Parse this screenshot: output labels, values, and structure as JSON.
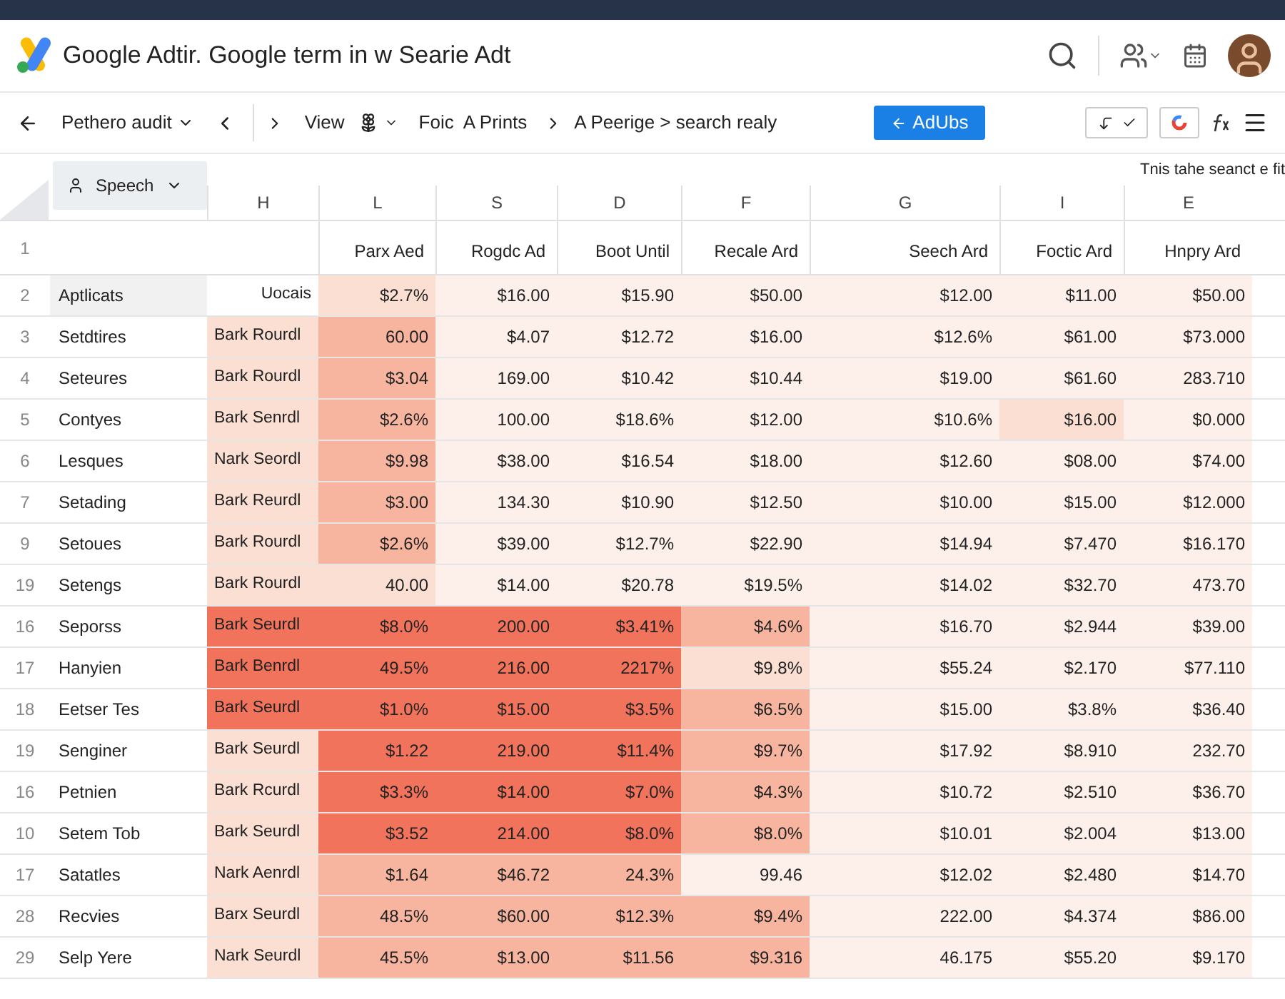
{
  "app": {
    "title": "Google Adtir. Google term in w Searie Adt"
  },
  "toolbar": {
    "document": "Pethero audit",
    "view": "View",
    "breadcrumb": "Foic  A Prints",
    "path": "A Peerige > search realy",
    "button": "AdUbs"
  },
  "sheet": {
    "name_box": "Speech",
    "note": "Tnis tahe seanct e fit",
    "column_letters": [
      "H",
      "L",
      "S",
      "D",
      "F",
      "G",
      "I",
      "E"
    ],
    "title_row_number": "1",
    "column_titles": [
      "Parx Aed",
      "Rogdc Ad",
      "Boot Until",
      "Recale Ard",
      "Seech Ard",
      "Foctic Ard",
      "Hnpry Ard"
    ],
    "rows": [
      {
        "number": "2",
        "kind": "header",
        "name": "Aptlicats",
        "cells": [
          {
            "text": "Uocais",
            "color": "#ffffff"
          },
          {
            "text": "$2.7%",
            "color": "#fbdfd3"
          },
          {
            "text": "$16.00",
            "color": "#fdf0ea"
          },
          {
            "text": "$15.90",
            "color": "#fdf0ea"
          },
          {
            "text": "$50.00",
            "color": "#fdf0ea"
          },
          {
            "text": "$12.00",
            "color": "#fdf0ea"
          },
          {
            "text": "$11.00",
            "color": "#fdf0ea"
          },
          {
            "text": "$50.00",
            "color": "#fdf0ea"
          }
        ]
      },
      {
        "number": "3",
        "kind": "data",
        "name": "Setdtires",
        "cells": [
          {
            "text": "Bark Rourdl",
            "color": "#fbdfd3"
          },
          {
            "text": "60.00",
            "color": "#f7b59f"
          },
          {
            "text": "$4.07",
            "color": "#fdf0ea"
          },
          {
            "text": "$12.72",
            "color": "#fdf0ea"
          },
          {
            "text": "$16.00",
            "color": "#fdf0ea"
          },
          {
            "text": "$12.6%",
            "color": "#fdf0ea"
          },
          {
            "text": "$61.00",
            "color": "#fdf0ea"
          },
          {
            "text": "$73.000",
            "color": "#fdf0ea"
          }
        ]
      },
      {
        "number": "4",
        "kind": "data",
        "name": "Seteures",
        "cells": [
          {
            "text": "Bark Rourdl",
            "color": "#fbdfd3"
          },
          {
            "text": "$3.04",
            "color": "#f7b59f"
          },
          {
            "text": "169.00",
            "color": "#fdf0ea"
          },
          {
            "text": "$10.42",
            "color": "#fdf0ea"
          },
          {
            "text": "$10.44",
            "color": "#fdf0ea"
          },
          {
            "text": "$19.00",
            "color": "#fdf0ea"
          },
          {
            "text": "$61.60",
            "color": "#fdf0ea"
          },
          {
            "text": "283.710",
            "color": "#fdf0ea"
          }
        ]
      },
      {
        "number": "5",
        "kind": "data",
        "name": "Contyes",
        "cells": [
          {
            "text": "Bark Senrdl",
            "color": "#fbdfd3"
          },
          {
            "text": "$2.6%",
            "color": "#f7b59f"
          },
          {
            "text": "100.00",
            "color": "#fdf0ea"
          },
          {
            "text": "$18.6%",
            "color": "#fdf0ea"
          },
          {
            "text": "$12.00",
            "color": "#fdf0ea"
          },
          {
            "text": "$10.6%",
            "color": "#fdf0ea"
          },
          {
            "text": "$16.00",
            "color": "#fbdfd3"
          },
          {
            "text": "$0.000",
            "color": "#fdf0ea"
          }
        ]
      },
      {
        "number": "6",
        "kind": "data",
        "name": "Lesques",
        "cells": [
          {
            "text": "Nark Seordl",
            "color": "#fbdfd3"
          },
          {
            "text": "$9.98",
            "color": "#f7b59f"
          },
          {
            "text": "$38.00",
            "color": "#fdf0ea"
          },
          {
            "text": "$16.54",
            "color": "#fdf0ea"
          },
          {
            "text": "$18.00",
            "color": "#fdf0ea"
          },
          {
            "text": "$12.60",
            "color": "#fdf0ea"
          },
          {
            "text": "$08.00",
            "color": "#fdf0ea"
          },
          {
            "text": "$74.00",
            "color": "#fdf0ea"
          }
        ]
      },
      {
        "number": "7",
        "kind": "data",
        "name": "Setading",
        "cells": [
          {
            "text": "Bark Reurdl",
            "color": "#fbdfd3"
          },
          {
            "text": "$3.00",
            "color": "#f7b59f"
          },
          {
            "text": "134.30",
            "color": "#fdf0ea"
          },
          {
            "text": "$10.90",
            "color": "#fdf0ea"
          },
          {
            "text": "$12.50",
            "color": "#fdf0ea"
          },
          {
            "text": "$10.00",
            "color": "#fdf0ea"
          },
          {
            "text": "$15.00",
            "color": "#fdf0ea"
          },
          {
            "text": "$12.000",
            "color": "#fdf0ea"
          }
        ]
      },
      {
        "number": "9",
        "kind": "data",
        "name": "Setoues",
        "cells": [
          {
            "text": "Bark Rourdl",
            "color": "#fbdfd3"
          },
          {
            "text": "$2.6%",
            "color": "#f7b59f"
          },
          {
            "text": "$39.00",
            "color": "#fdf0ea"
          },
          {
            "text": "$12.7%",
            "color": "#fdf0ea"
          },
          {
            "text": "$22.90",
            "color": "#fdf0ea"
          },
          {
            "text": "$14.94",
            "color": "#fdf0ea"
          },
          {
            "text": "$7.470",
            "color": "#fdf0ea"
          },
          {
            "text": "$16.170",
            "color": "#fdf0ea"
          }
        ]
      },
      {
        "number": "19",
        "kind": "data",
        "name": "Setengs",
        "cells": [
          {
            "text": "Bark Rourdl",
            "color": "#fbdfd3"
          },
          {
            "text": "40.00",
            "color": "#fbdfd3"
          },
          {
            "text": "$14.00",
            "color": "#fdf0ea"
          },
          {
            "text": "$20.78",
            "color": "#fdf0ea"
          },
          {
            "text": "$19.5%",
            "color": "#fdf0ea"
          },
          {
            "text": "$14.02",
            "color": "#fdf0ea"
          },
          {
            "text": "$32.70",
            "color": "#fdf0ea"
          },
          {
            "text": "473.70",
            "color": "#fdf0ea"
          }
        ]
      },
      {
        "number": "16",
        "kind": "data",
        "name": "Seporss",
        "cells": [
          {
            "text": "Bark Seurdl",
            "color": "#f1735b"
          },
          {
            "text": "$8.0%",
            "color": "#f1735b"
          },
          {
            "text": "200.00",
            "color": "#f1735b"
          },
          {
            "text": "$3.41%",
            "color": "#f1735b"
          },
          {
            "text": "$4.6%",
            "color": "#f7b59f"
          },
          {
            "text": "$16.70",
            "color": "#fdf0ea"
          },
          {
            "text": "$2.944",
            "color": "#fdf0ea"
          },
          {
            "text": "$39.00",
            "color": "#fdf0ea"
          }
        ]
      },
      {
        "number": "17",
        "kind": "data",
        "name": "Hanyien",
        "cells": [
          {
            "text": "Bark Benrdl",
            "color": "#f1735b"
          },
          {
            "text": "49.5%",
            "color": "#f1735b"
          },
          {
            "text": "216.00",
            "color": "#f1735b"
          },
          {
            "text": "2217%",
            "color": "#f1735b"
          },
          {
            "text": "$9.8%",
            "color": "#fbdfd3"
          },
          {
            "text": "$55.24",
            "color": "#fdf0ea"
          },
          {
            "text": "$2.170",
            "color": "#fdf0ea"
          },
          {
            "text": "$77.110",
            "color": "#fdf0ea"
          }
        ]
      },
      {
        "number": "18",
        "kind": "data",
        "name": "Eetser Tes",
        "cells": [
          {
            "text": "Bark Seurdl",
            "color": "#f1735b"
          },
          {
            "text": "$1.0%",
            "color": "#f1735b"
          },
          {
            "text": "$15.00",
            "color": "#f1735b"
          },
          {
            "text": "$3.5%",
            "color": "#f1735b"
          },
          {
            "text": "$6.5%",
            "color": "#f7b59f"
          },
          {
            "text": "$15.00",
            "color": "#fdf0ea"
          },
          {
            "text": "$3.8%",
            "color": "#fdf0ea"
          },
          {
            "text": "$36.40",
            "color": "#fdf0ea"
          }
        ]
      },
      {
        "number": "19",
        "kind": "data",
        "name": "Senginer",
        "cells": [
          {
            "text": "Bark Seurdl",
            "color": "#fbdfd3"
          },
          {
            "text": "$1.22",
            "color": "#f1735b"
          },
          {
            "text": "219.00",
            "color": "#f1735b"
          },
          {
            "text": "$11.4%",
            "color": "#f1735b"
          },
          {
            "text": "$9.7%",
            "color": "#f7b59f"
          },
          {
            "text": "$17.92",
            "color": "#fdf0ea"
          },
          {
            "text": "$8.910",
            "color": "#fdf0ea"
          },
          {
            "text": "232.70",
            "color": "#fdf0ea"
          }
        ]
      },
      {
        "number": "16",
        "kind": "data",
        "name": "Petnien",
        "cells": [
          {
            "text": "Bark Rcurdl",
            "color": "#fbdfd3"
          },
          {
            "text": "$3.3%",
            "color": "#f1735b"
          },
          {
            "text": "$14.00",
            "color": "#f1735b"
          },
          {
            "text": "$7.0%",
            "color": "#f1735b"
          },
          {
            "text": "$4.3%",
            "color": "#f7b59f"
          },
          {
            "text": "$10.72",
            "color": "#fdf0ea"
          },
          {
            "text": "$2.510",
            "color": "#fdf0ea"
          },
          {
            "text": "$36.70",
            "color": "#fdf0ea"
          }
        ]
      },
      {
        "number": "10",
        "kind": "data",
        "name": "Setem Tob",
        "cells": [
          {
            "text": "Bark Seurdl",
            "color": "#fbdfd3"
          },
          {
            "text": "$3.52",
            "color": "#f1735b"
          },
          {
            "text": "214.00",
            "color": "#f1735b"
          },
          {
            "text": "$8.0%",
            "color": "#f1735b"
          },
          {
            "text": "$8.0%",
            "color": "#f7b59f"
          },
          {
            "text": "$10.01",
            "color": "#fdf0ea"
          },
          {
            "text": "$2.004",
            "color": "#fdf0ea"
          },
          {
            "text": "$13.00",
            "color": "#fdf0ea"
          }
        ]
      },
      {
        "number": "17",
        "kind": "data",
        "name": "Satatles",
        "cells": [
          {
            "text": "Nark Aenrdl",
            "color": "#fbdfd3"
          },
          {
            "text": "$1.64",
            "color": "#f7b59f"
          },
          {
            "text": "$46.72",
            "color": "#f7b59f"
          },
          {
            "text": "24.3%",
            "color": "#f7b59f"
          },
          {
            "text": "99.46",
            "color": "#fdf0ea"
          },
          {
            "text": "$12.02",
            "color": "#fdf0ea"
          },
          {
            "text": "$2.480",
            "color": "#fdf0ea"
          },
          {
            "text": "$14.70",
            "color": "#fdf0ea"
          }
        ]
      },
      {
        "number": "28",
        "kind": "data",
        "name": "Recvies",
        "cells": [
          {
            "text": "Barx Seurdl",
            "color": "#fbdfd3"
          },
          {
            "text": "48.5%",
            "color": "#f7b59f"
          },
          {
            "text": "$60.00",
            "color": "#f7b59f"
          },
          {
            "text": "$12.3%",
            "color": "#f7b59f"
          },
          {
            "text": "$9.4%",
            "color": "#f7b59f"
          },
          {
            "text": "222.00",
            "color": "#fdf0ea"
          },
          {
            "text": "$4.374",
            "color": "#fdf0ea"
          },
          {
            "text": "$86.00",
            "color": "#fdf0ea"
          }
        ]
      },
      {
        "number": "29",
        "kind": "data",
        "name": "Selp Yere",
        "cells": [
          {
            "text": "Nark Seurdl",
            "color": "#fbdfd3"
          },
          {
            "text": "45.5%",
            "color": "#f7b59f"
          },
          {
            "text": "$13.00",
            "color": "#f7b59f"
          },
          {
            "text": "$11.56",
            "color": "#f7b59f"
          },
          {
            "text": "$9.316",
            "color": "#f7b59f"
          },
          {
            "text": "46.175",
            "color": "#fdf0ea"
          },
          {
            "text": "$55.20",
            "color": "#fdf0ea"
          },
          {
            "text": "$9.170",
            "color": "#fdf0ea"
          }
        ]
      }
    ]
  }
}
